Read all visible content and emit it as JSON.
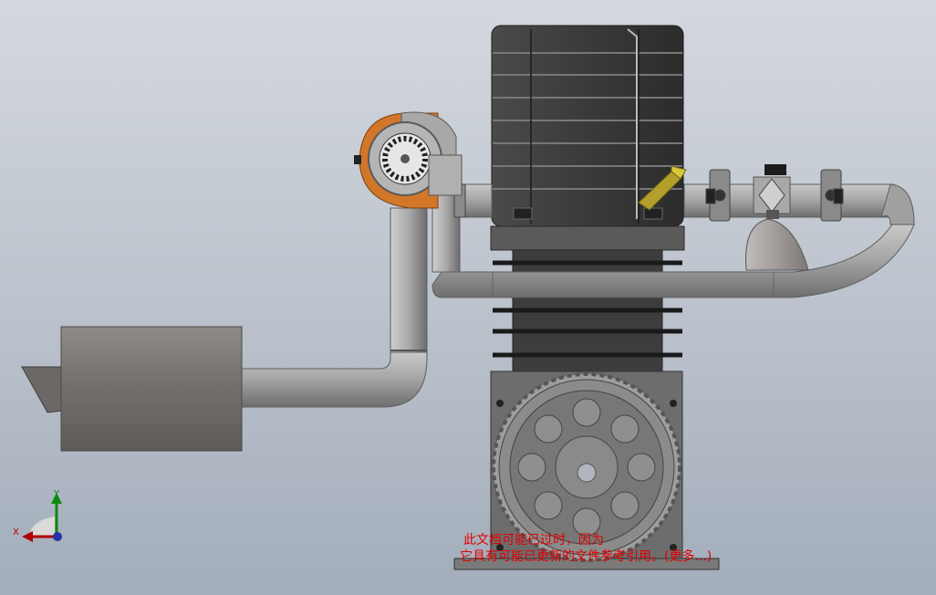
{
  "viewport": {
    "background_top": "#d4d8de",
    "background_bottom": "#a3adbb"
  },
  "colors": {
    "engine_dark": "#3a3a3a",
    "pipe_gray": "#9a9a9a",
    "turbo_orange": "#d2772a",
    "valve_brass": "#b3a02a",
    "gear_gray": "#7a7a7a",
    "watermark_red": "#e00000"
  },
  "components": {
    "engine": "engine-block",
    "turbo": "turbocharger",
    "muffler": "muffler",
    "valve": "valve-assembly",
    "gear": "gear-cover"
  },
  "triad": {
    "x_label": "X",
    "y_label": "Y"
  },
  "watermark": {
    "line1": "此文档可能已过时，因为",
    "line2": "它具有可能已更新的文件参考引用。(更多...)"
  }
}
